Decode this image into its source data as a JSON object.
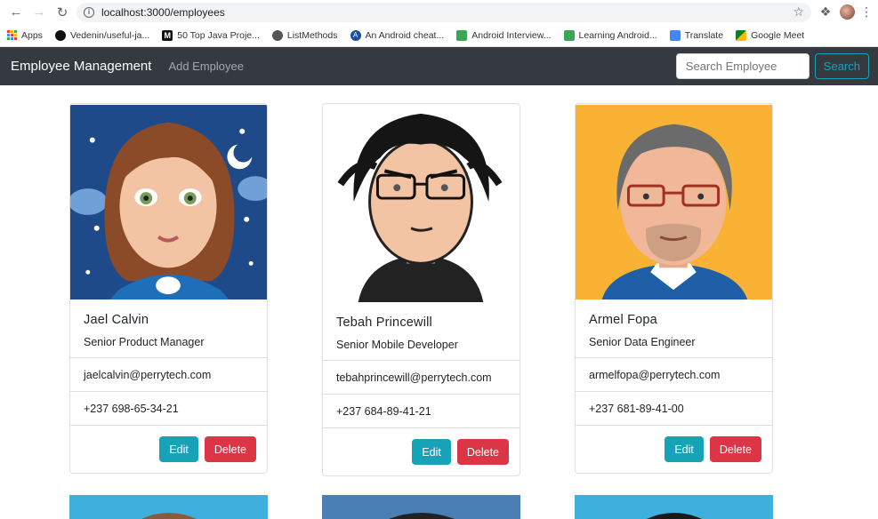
{
  "browser": {
    "url": "localhost:3000/employees",
    "bookmarks": [
      {
        "label": "Apps",
        "icon": "apps-grid-icon"
      },
      {
        "label": "Vedenin/useful-ja...",
        "icon": "github-icon"
      },
      {
        "label": "50 Top Java Proje...",
        "icon": "medium-icon"
      },
      {
        "label": "ListMethods",
        "icon": "globe-icon"
      },
      {
        "label": "An Android cheat...",
        "icon": "android-icon"
      },
      {
        "label": "Android Interview...",
        "icon": "android-interview-icon"
      },
      {
        "label": "Learning Android...",
        "icon": "learning-icon"
      },
      {
        "label": "Translate",
        "icon": "translate-icon"
      },
      {
        "label": "Google Meet",
        "icon": "meet-icon"
      }
    ]
  },
  "navbar": {
    "brand": "Employee Management",
    "add_link": "Add Employee",
    "search_placeholder": "Search Employee",
    "search_button": "Search"
  },
  "employees": [
    {
      "name": "Jael Calvin",
      "title": "Senior Product Manager",
      "email": "jaelcalvin@perrytech.com",
      "phone": "+237 698-65-34-21",
      "avatar": "female-avatar",
      "bg": "#1e4a8a"
    },
    {
      "name": "Tebah Princewill",
      "title": "Senior Mobile Developer",
      "email": "tebahprincewill@perrytech.com",
      "phone": "+237 684-89-41-21",
      "avatar": "male-glasses-avatar",
      "bg": "#ffffff"
    },
    {
      "name": "Armel Fopa",
      "title": "Senior Data Engineer",
      "email": "armelfopa@perrytech.com",
      "phone": "+237 681-89-41-00",
      "avatar": "bearded-avatar",
      "bg": "#f9b233"
    }
  ],
  "actions": {
    "edit": "Edit",
    "delete": "Delete"
  },
  "colors": {
    "navbar": "#343a40",
    "info": "#17a2b8",
    "danger": "#dc3545"
  }
}
